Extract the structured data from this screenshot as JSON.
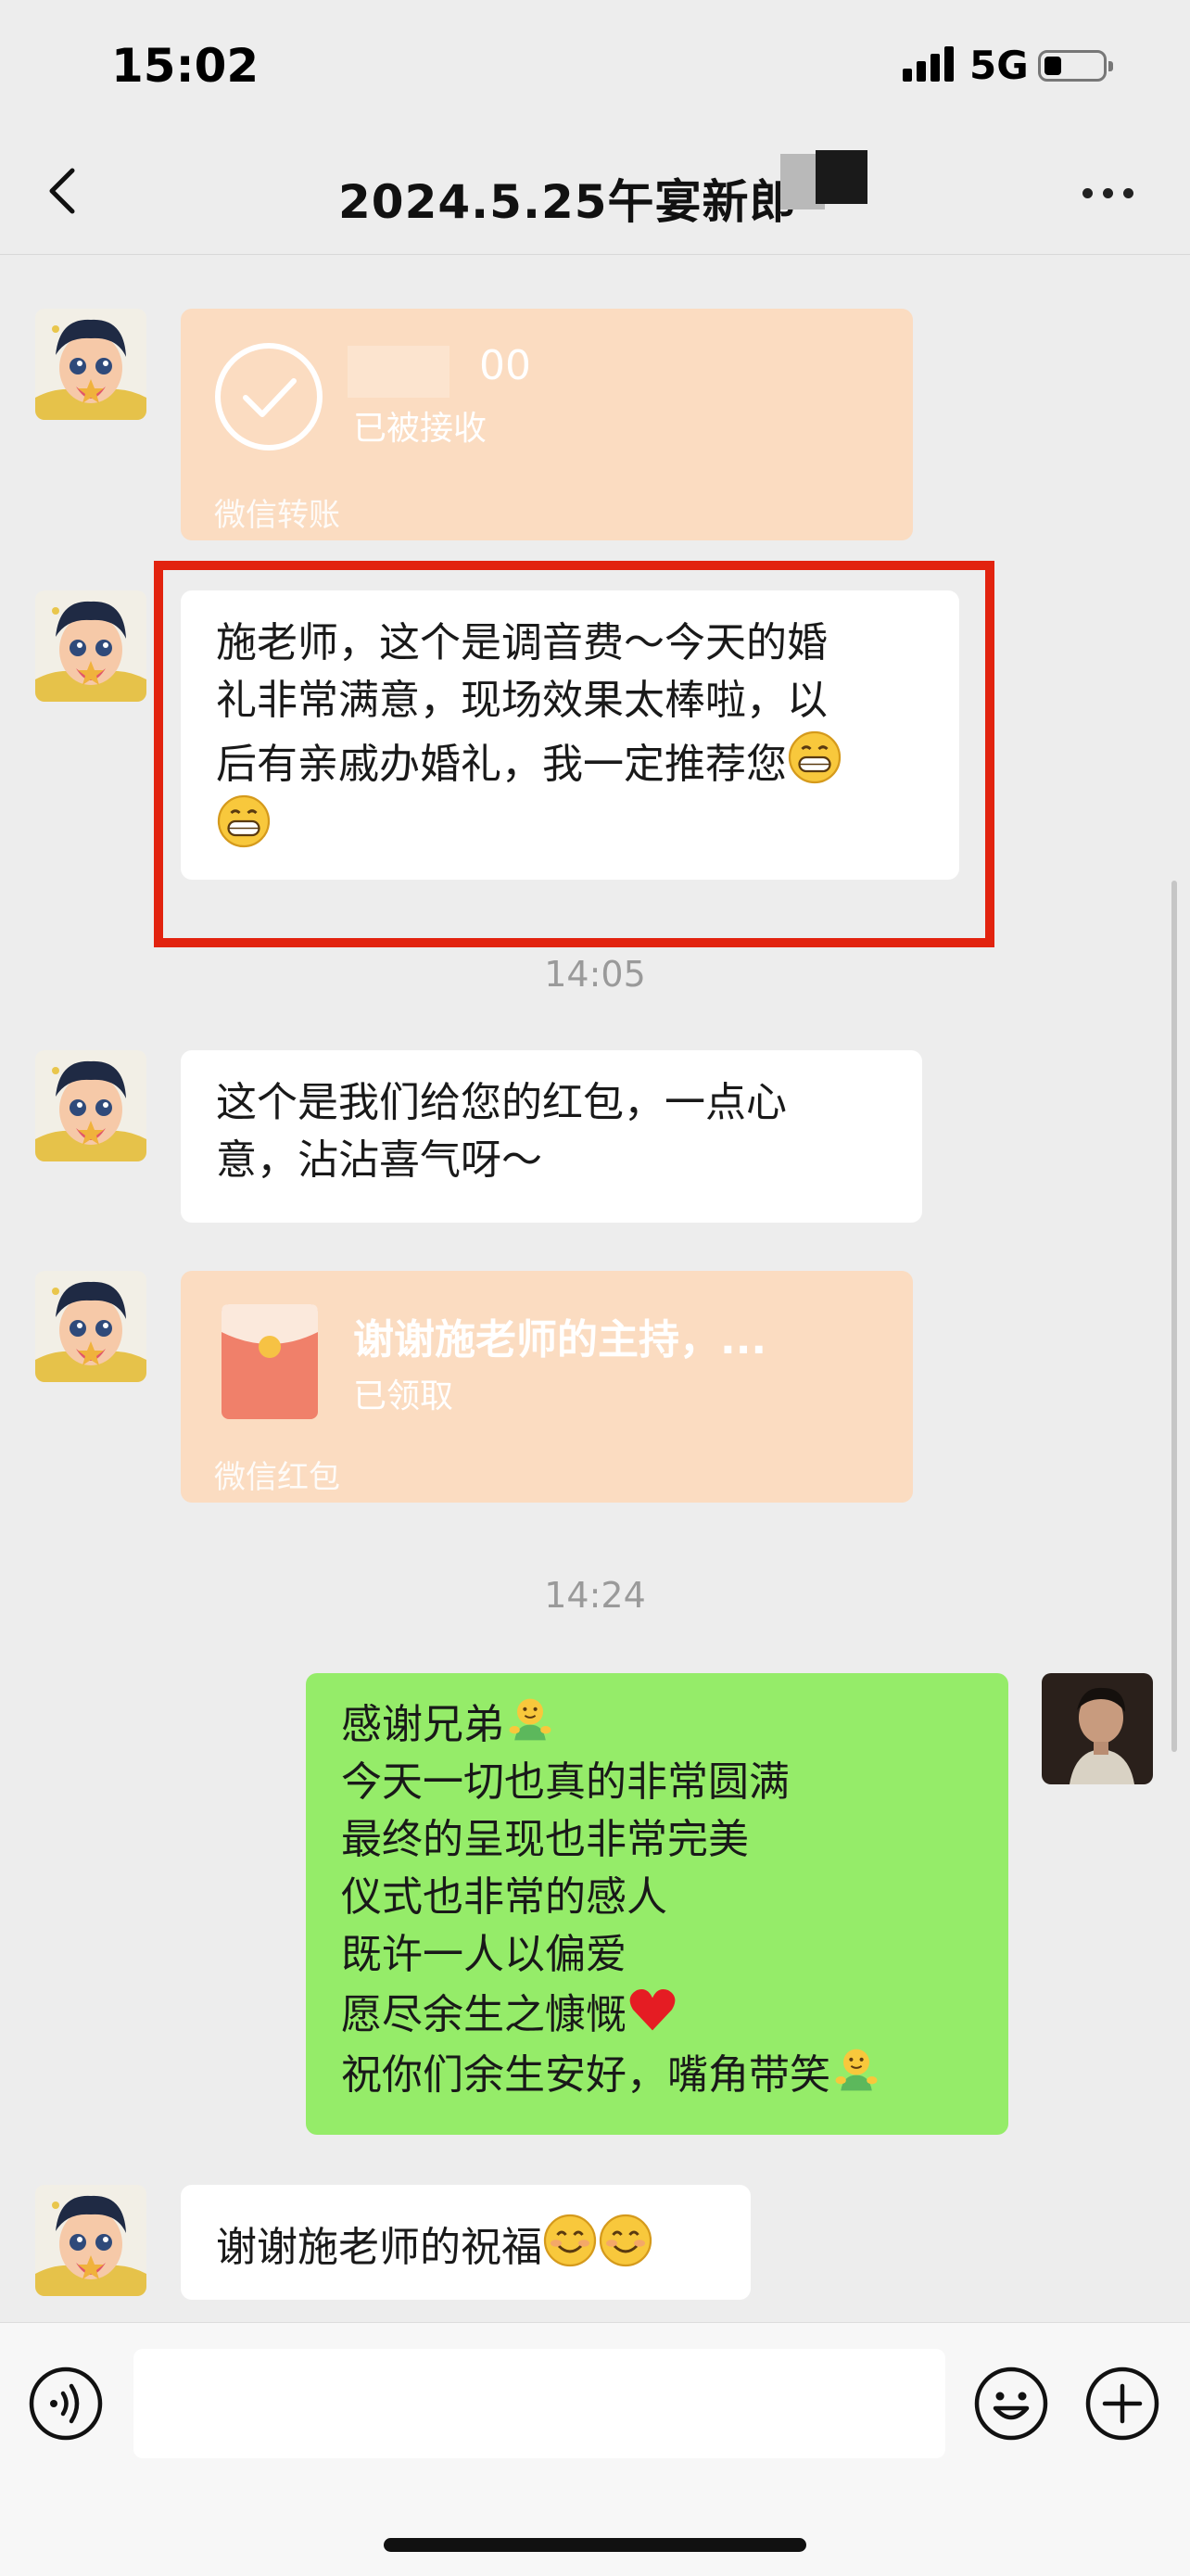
{
  "status_bar": {
    "time": "15:02",
    "network": "5G",
    "battery_icon": "battery-icon",
    "signal_icon": "signal-icon"
  },
  "nav": {
    "title": "2024.5.25午宴新郎",
    "back_icon": "chevron-left-icon",
    "more_icon": "ellipsis-icon"
  },
  "messages": {
    "transfer": {
      "amount": "00",
      "status": "已被接收",
      "label": "微信转账"
    },
    "msg1": {
      "lines": [
        "施老师，这个是调音费～今天的婚",
        "礼非常满意，现场效果太棒啦，以",
        "后有亲戚办婚礼，我一定推荐您"
      ]
    },
    "time1": "14:05",
    "msg2": {
      "lines": [
        "这个是我们给您的红包，一点心",
        "意，沾沾喜气呀～"
      ]
    },
    "red_packet": {
      "title": "谢谢施老师的主持，...",
      "status": "已领取",
      "label": "微信红包"
    },
    "time2": "14:24",
    "msg3": {
      "lines": [
        "感谢兄弟",
        "今天一切也真的非常圆满",
        "最终的呈现也非常完美",
        "仪式也非常的感人",
        "既许一人以偏爱",
        "愿尽余生之慷慨",
        "祝你们余生安好，嘴角带笑"
      ]
    },
    "msg4": {
      "text": "谢谢施老师的祝福"
    }
  },
  "input_bar": {
    "voice_icon": "voice-icon",
    "emoji_icon": "emoji-icon",
    "plus_icon": "plus-icon",
    "placeholder": ""
  },
  "colors": {
    "background": "#ededed",
    "self_bubble": "#95ec69",
    "other_bubble": "#ffffff",
    "card": "#fbdcc1",
    "highlight_box": "#e2230f"
  }
}
